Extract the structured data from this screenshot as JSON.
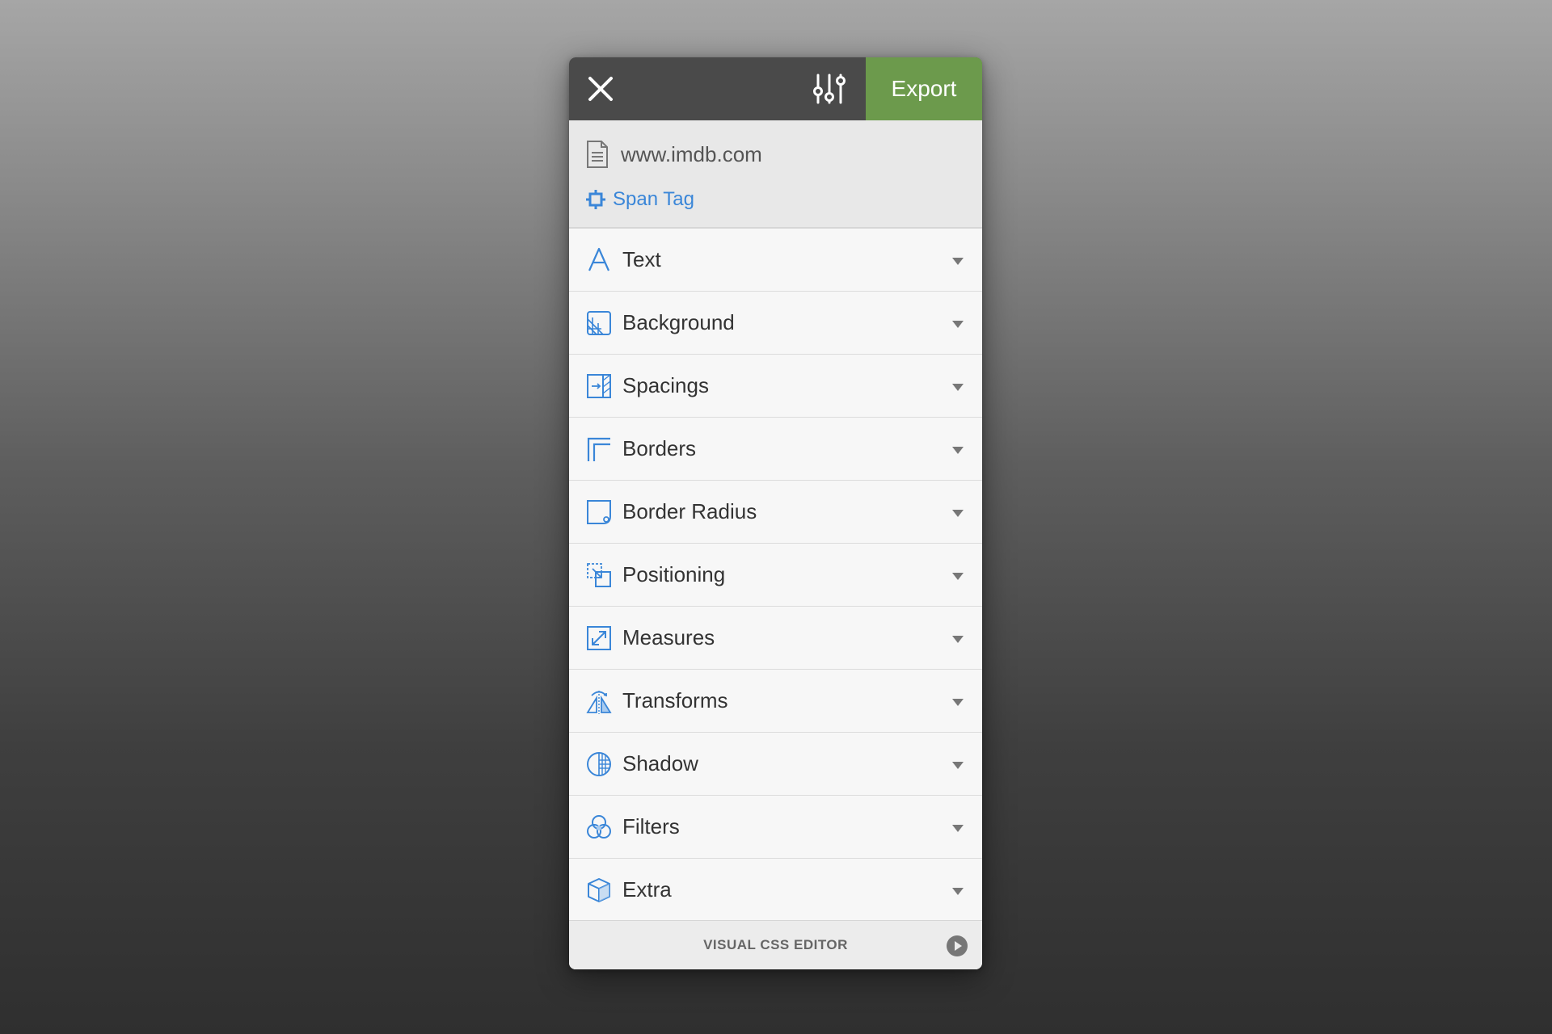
{
  "colors": {
    "accent": "#3a86d8",
    "export_bg": "#6c9a4c",
    "topbar_bg": "#4a4a4a"
  },
  "topbar": {
    "close_icon": "close-icon",
    "settings_icon": "sliders-icon",
    "export_label": "Export"
  },
  "info": {
    "site_icon": "document-icon",
    "site": "www.imdb.com",
    "tag_icon": "chip-icon",
    "tag": "Span Tag"
  },
  "menu": {
    "items": [
      {
        "label": "Text",
        "icon": "text-icon"
      },
      {
        "label": "Background",
        "icon": "background-icon"
      },
      {
        "label": "Spacings",
        "icon": "spacings-icon"
      },
      {
        "label": "Borders",
        "icon": "borders-icon"
      },
      {
        "label": "Border Radius",
        "icon": "border-radius-icon"
      },
      {
        "label": "Positioning",
        "icon": "positioning-icon"
      },
      {
        "label": "Measures",
        "icon": "measures-icon"
      },
      {
        "label": "Transforms",
        "icon": "transforms-icon"
      },
      {
        "label": "Shadow",
        "icon": "shadow-icon"
      },
      {
        "label": "Filters",
        "icon": "filters-icon"
      },
      {
        "label": "Extra",
        "icon": "cube-icon"
      }
    ]
  },
  "footer": {
    "title": "VISUAL CSS EDITOR",
    "play_icon": "play-icon"
  }
}
